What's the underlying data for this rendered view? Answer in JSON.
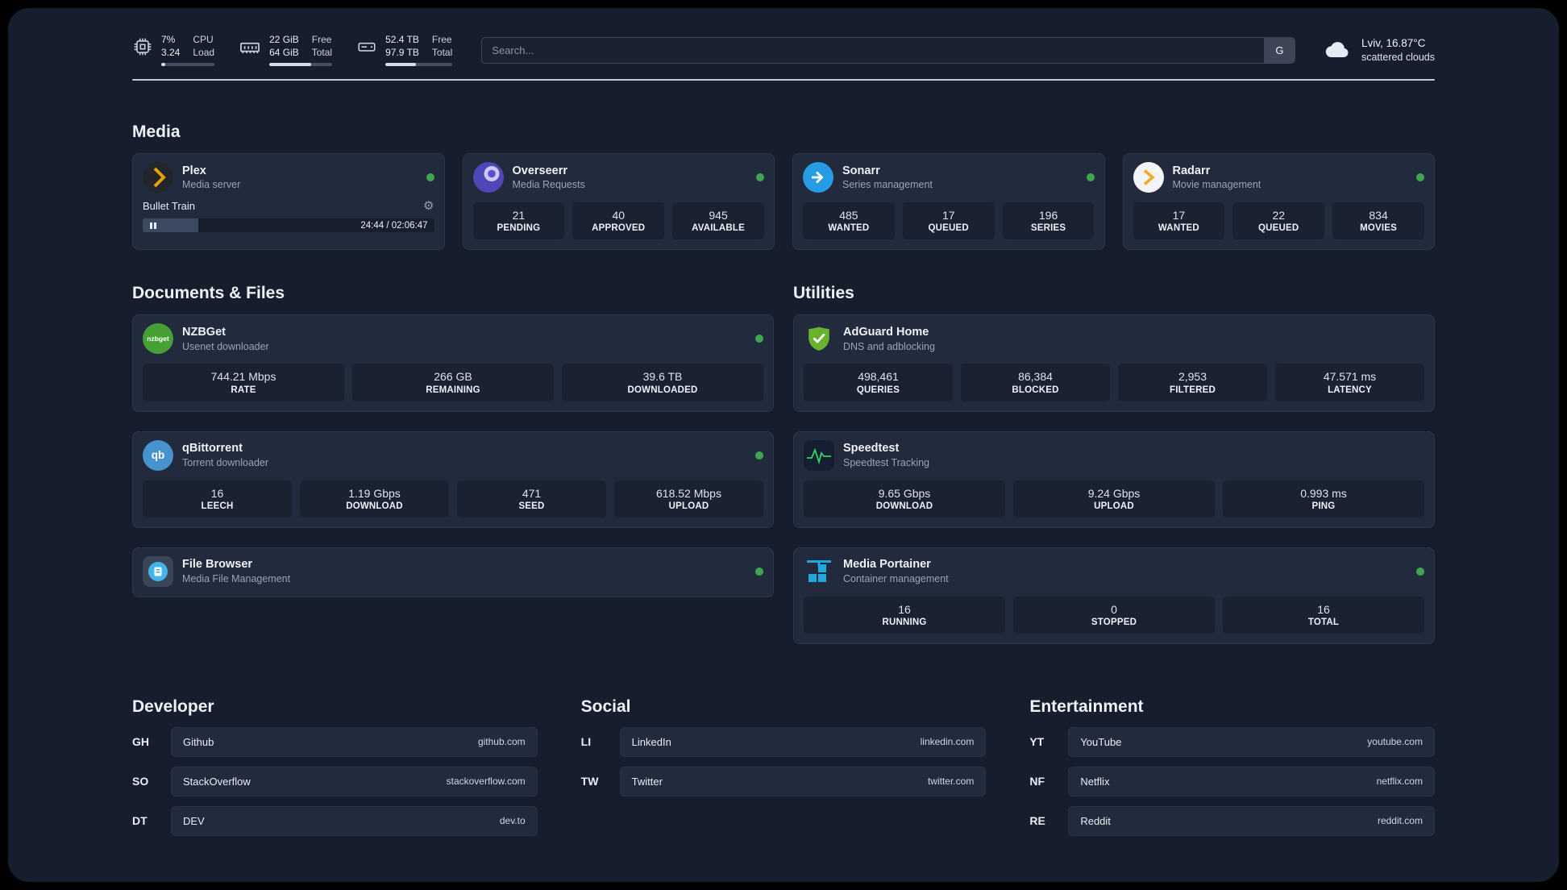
{
  "colors": {
    "status_online": "#41a653",
    "plex_accent": "#e5a00d",
    "sonarr_accent": "#259ce3",
    "radarr_accent": "#f9a825",
    "nzbget_accent": "#46a135",
    "qbittorrent_accent": "#4793ce",
    "adguard_accent": "#67b32e",
    "speedtest_accent": "#34d05c",
    "portainer_accent": "#1fa9dc"
  },
  "topbar": {
    "cpu": {
      "value_primary": "7%",
      "value_secondary": "3.24",
      "label_primary": "CPU",
      "label_secondary": "Load",
      "progress_percent": 7
    },
    "memory": {
      "value_primary": "22 GiB",
      "value_secondary": "64 GiB",
      "label_primary": "Free",
      "label_secondary": "Total",
      "progress_percent": 66
    },
    "storage": {
      "value_primary": "52.4 TB",
      "value_secondary": "97.9 TB",
      "label_primary": "Free",
      "label_secondary": "Total",
      "progress_percent": 46
    },
    "search": {
      "placeholder": "Search...",
      "engine_label": "G"
    },
    "weather": {
      "location": "Lviv, 16.87°C",
      "condition": "scattered clouds"
    }
  },
  "sections": {
    "media_title": "Media",
    "documents_title": "Documents & Files",
    "utilities_title": "Utilities",
    "developer_title": "Developer",
    "social_title": "Social",
    "entertainment_title": "Entertainment"
  },
  "apps": {
    "plex": {
      "name": "Plex",
      "description": "Media server",
      "status": "online",
      "now_playing": {
        "title": "Bullet Train",
        "time_display": "24:44 / 02:06:47",
        "progress_percent": 19
      }
    },
    "overseerr": {
      "name": "Overseerr",
      "description": "Media Requests",
      "status": "online",
      "stats": [
        {
          "value": "21",
          "label": "PENDING"
        },
        {
          "value": "40",
          "label": "APPROVED"
        },
        {
          "value": "945",
          "label": "AVAILABLE"
        }
      ]
    },
    "sonarr": {
      "name": "Sonarr",
      "description": "Series management",
      "status": "online",
      "stats": [
        {
          "value": "485",
          "label": "WANTED"
        },
        {
          "value": "17",
          "label": "QUEUED"
        },
        {
          "value": "196",
          "label": "SERIES"
        }
      ]
    },
    "radarr": {
      "name": "Radarr",
      "description": "Movie management",
      "status": "online",
      "stats": [
        {
          "value": "17",
          "label": "WANTED"
        },
        {
          "value": "22",
          "label": "QUEUED"
        },
        {
          "value": "834",
          "label": "MOVIES"
        }
      ]
    },
    "nzbget": {
      "name": "NZBGet",
      "description": "Usenet downloader",
      "status": "online",
      "stats": [
        {
          "value": "744.21 Mbps",
          "label": "RATE"
        },
        {
          "value": "266 GB",
          "label": "REMAINING"
        },
        {
          "value": "39.6 TB",
          "label": "DOWNLOADED"
        }
      ]
    },
    "qbittorrent": {
      "name": "qBittorrent",
      "description": "Torrent downloader",
      "status": "online",
      "stats": [
        {
          "value": "16",
          "label": "LEECH"
        },
        {
          "value": "1.19 Gbps",
          "label": "DOWNLOAD"
        },
        {
          "value": "471",
          "label": "SEED"
        },
        {
          "value": "618.52 Mbps",
          "label": "UPLOAD"
        }
      ]
    },
    "filebrowser": {
      "name": "File Browser",
      "description": "Media File Management",
      "status": "online"
    },
    "adguard": {
      "name": "AdGuard Home",
      "description": "DNS and adblocking",
      "stats": [
        {
          "value": "498,461",
          "label": "QUERIES"
        },
        {
          "value": "86,384",
          "label": "BLOCKED"
        },
        {
          "value": "2,953",
          "label": "FILTERED"
        },
        {
          "value": "47.571 ms",
          "label": "LATENCY"
        }
      ]
    },
    "speedtest": {
      "name": "Speedtest",
      "description": "Speedtest Tracking",
      "stats": [
        {
          "value": "9.65 Gbps",
          "label": "DOWNLOAD"
        },
        {
          "value": "9.24 Gbps",
          "label": "UPLOAD"
        },
        {
          "value": "0.993 ms",
          "label": "PING"
        }
      ]
    },
    "portainer": {
      "name": "Media Portainer",
      "description": "Container management",
      "status": "online",
      "stats": [
        {
          "value": "16",
          "label": "RUNNING"
        },
        {
          "value": "0",
          "label": "STOPPED"
        },
        {
          "value": "16",
          "label": "TOTAL"
        }
      ]
    }
  },
  "bookmarks": {
    "developer": [
      {
        "abbr": "GH",
        "name": "Github",
        "url": "github.com"
      },
      {
        "abbr": "SO",
        "name": "StackOverflow",
        "url": "stackoverflow.com"
      },
      {
        "abbr": "DT",
        "name": "DEV",
        "url": "dev.to"
      }
    ],
    "social": [
      {
        "abbr": "LI",
        "name": "LinkedIn",
        "url": "linkedin.com"
      },
      {
        "abbr": "TW",
        "name": "Twitter",
        "url": "twitter.com"
      }
    ],
    "entertainment": [
      {
        "abbr": "YT",
        "name": "YouTube",
        "url": "youtube.com"
      },
      {
        "abbr": "NF",
        "name": "Netflix",
        "url": "netflix.com"
      },
      {
        "abbr": "RE",
        "name": "Reddit",
        "url": "reddit.com"
      }
    ]
  },
  "icons": {
    "gear": "⚙",
    "nzbget_label": "nzbget",
    "qbittorrent_label": "qb"
  }
}
